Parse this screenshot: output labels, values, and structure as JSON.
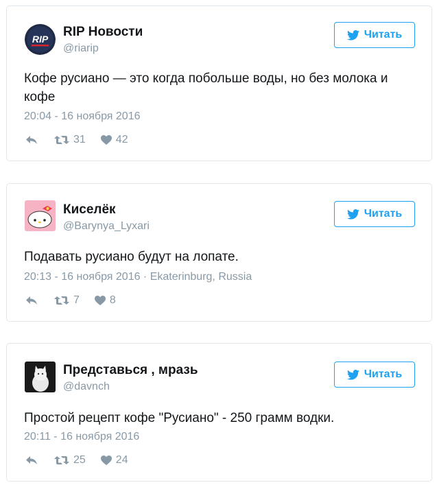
{
  "colors": {
    "accent": "#1da1f2",
    "muted": "#8899a6",
    "text": "#14171a",
    "border": "#e1e8ed"
  },
  "follow_label": "Читать",
  "tweets": [
    {
      "name": "RIP Новости",
      "handle": "@riarip",
      "avatar_text": "RIP",
      "text": "Кофе русиано — это когда побольше воды, но без молока и кофе",
      "meta": "20:04 - 16 ноября 2016",
      "retweets": "31",
      "likes": "42"
    },
    {
      "name": "Киселёк",
      "handle": "@Barynya_Lyxari",
      "text": "Подавать русиано будут на лопате.",
      "meta": "20:13 - 16 ноября 2016 · Ekaterinburg, Russia",
      "retweets": "7",
      "likes": "8"
    },
    {
      "name": "Представься , мразь",
      "handle": "@davnch",
      "text": "Простой рецепт кофе \"Русиано\" - 250 грамм водки.",
      "meta": "20:11 - 16 ноября 2016",
      "retweets": "25",
      "likes": "24"
    }
  ]
}
